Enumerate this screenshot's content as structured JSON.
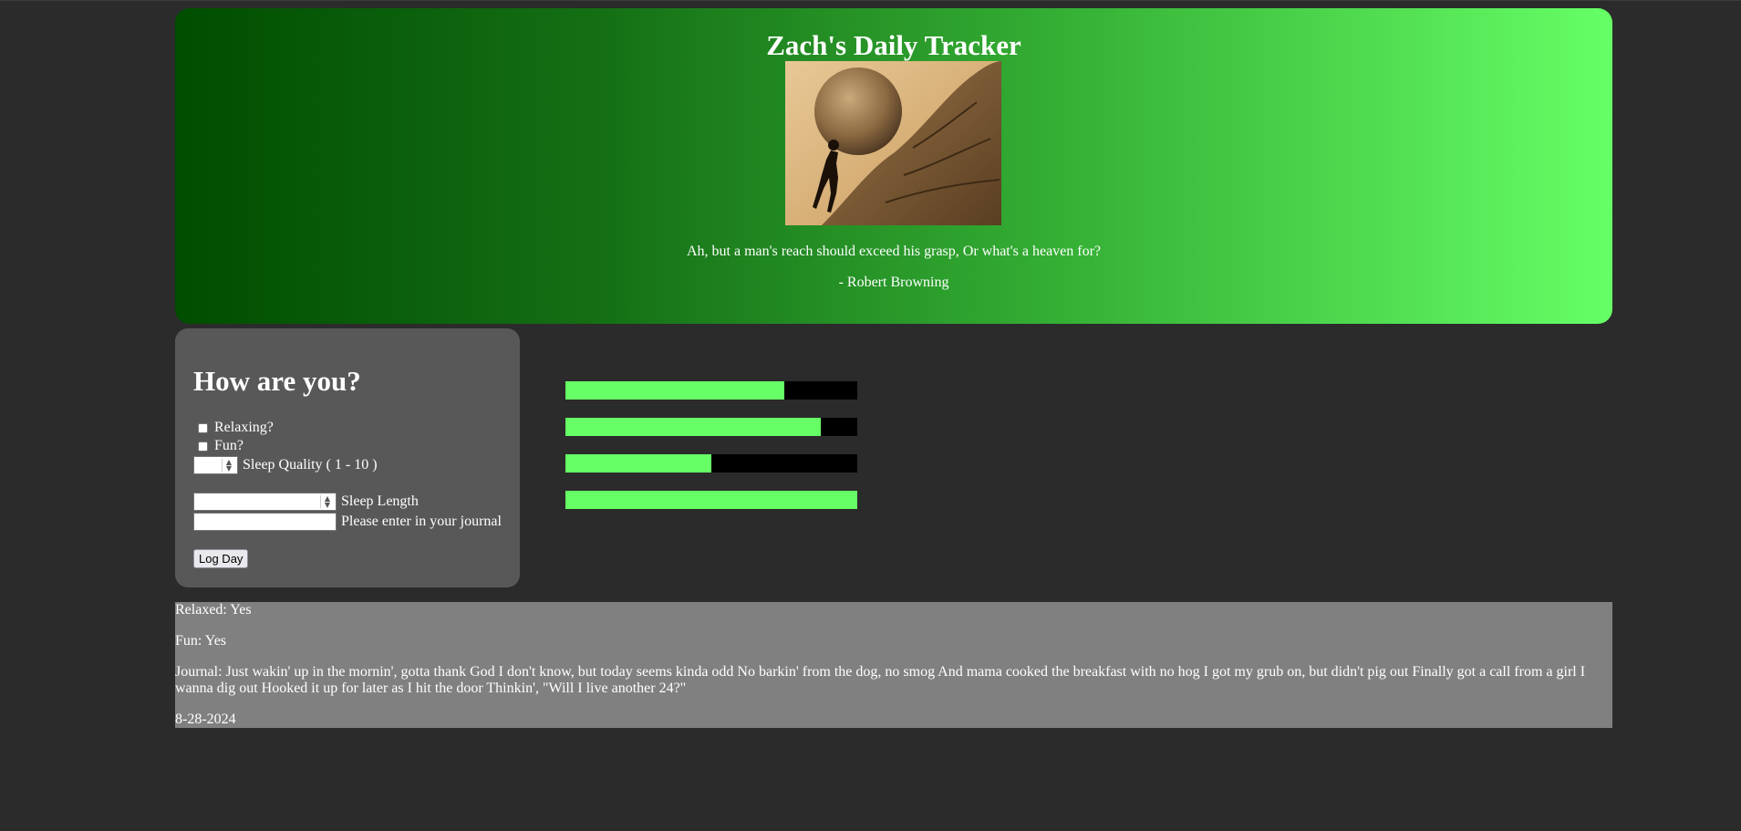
{
  "header": {
    "title": "Zach's Daily Tracker",
    "quote": "Ah, but a man's reach should exceed his grasp, Or what's a heaven for?",
    "author": "- Robert Browning"
  },
  "form": {
    "heading": "How are you?",
    "relaxing_label": "Relaxing?",
    "fun_label": "Fun?",
    "sleep_quality_label": "Sleep Quality ( 1 - 10 )",
    "sleep_length_label": "Sleep Length",
    "journal_label": "Please enter in your journal",
    "submit_label": "Log Day",
    "relaxing_checked": false,
    "fun_checked": false,
    "sleep_quality_value": "",
    "sleep_length_value": "",
    "journal_value": ""
  },
  "bars": [
    {
      "fill": 0.75
    },
    {
      "fill": 0.875
    },
    {
      "fill": 0.5
    },
    {
      "fill": 1.0
    }
  ],
  "bar_colors": {
    "fill": "#66ff66",
    "track": "#000000"
  },
  "entry": {
    "relaxed": "Relaxed: Yes",
    "fun": "Fun: Yes",
    "journal": "Journal: Just wakin' up in the mornin', gotta thank God I don't know, but today seems kinda odd No barkin' from the dog, no smog And mama cooked the breakfast with no hog I got my grub on, but didn't pig out Finally got a call from a girl I wanna dig out Hooked it up for later as I hit the door Thinkin', \"Will I live another 24?\"",
    "date": "8-28-2024"
  }
}
